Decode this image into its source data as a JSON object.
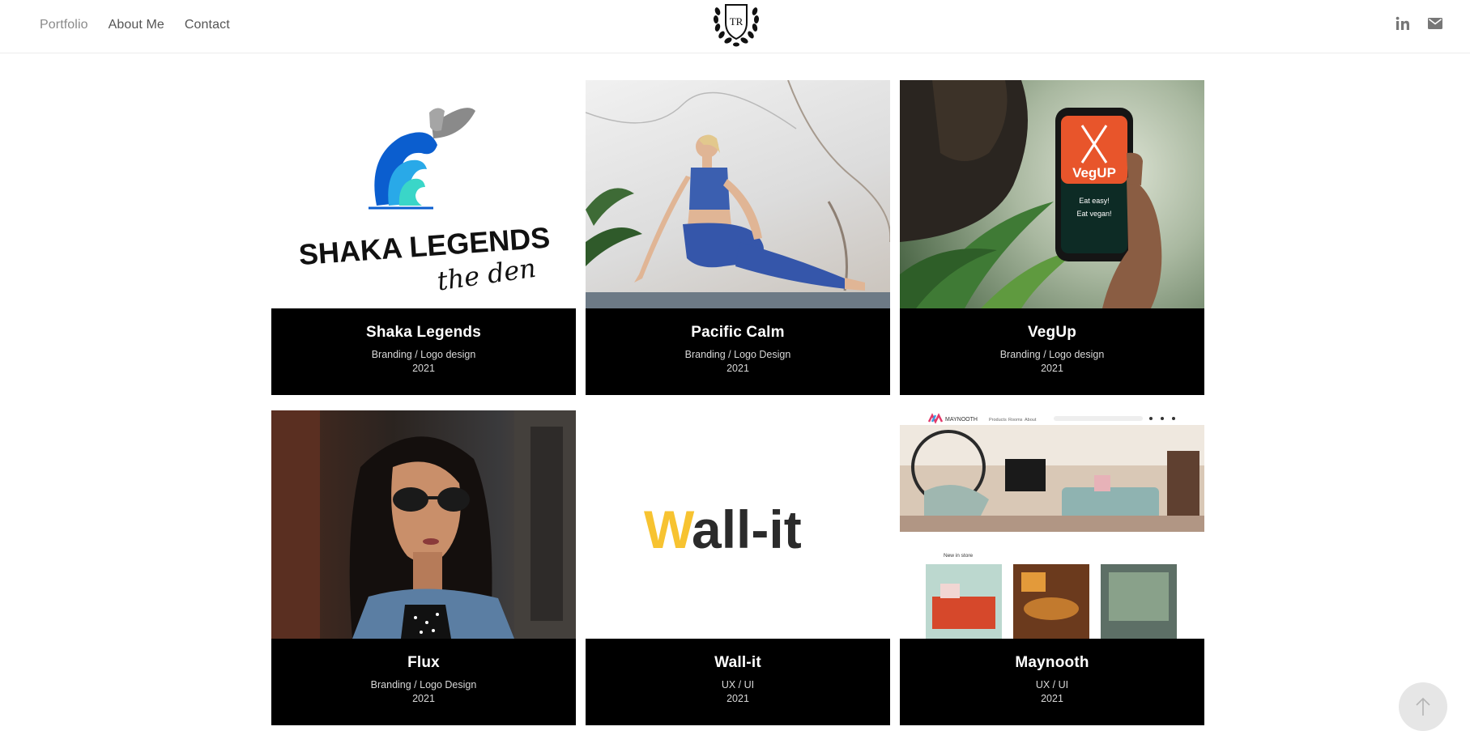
{
  "nav": {
    "items": [
      {
        "label": "Portfolio",
        "active": true
      },
      {
        "label": "About Me",
        "active": false
      },
      {
        "label": "Contact",
        "active": false
      }
    ]
  },
  "logo": {
    "monogram": "TR"
  },
  "social": [
    {
      "icon": "linkedin-icon",
      "glyph": "in"
    },
    {
      "icon": "mail-icon"
    }
  ],
  "projects": [
    {
      "title": "Shaka Legends",
      "category": "Branding / Logo design",
      "year": "2021",
      "thumb_text_1": "SHAKA LEGENDS",
      "thumb_text_2": "the den"
    },
    {
      "title": "Pacific Calm",
      "category": "Branding / Logo Design",
      "year": "2021"
    },
    {
      "title": "VegUp",
      "category": "Branding / Logo design",
      "year": "2021",
      "thumb_text_1": "VegUP",
      "thumb_text_2": "Eat easy!",
      "thumb_text_3": "Eat vegan!"
    },
    {
      "title": "Flux",
      "category": "Branding / Logo Design",
      "year": "2021"
    },
    {
      "title": "Wall-it",
      "category": "UX / UI",
      "year": "2021",
      "thumb_text_1": "W",
      "thumb_text_2": "all-it"
    },
    {
      "title": "Maynooth",
      "category": "UX / UI",
      "year": "2021",
      "thumb_text_1": "MAYNOOTH",
      "thumb_text_2": "Products",
      "thumb_text_3": "Rooms",
      "thumb_text_4": "About",
      "thumb_text_5": "New in store"
    }
  ],
  "colors": {
    "accent_yellow": "#f7c331",
    "vegup_orange": "#e8552b",
    "caption_bg": "#000000"
  }
}
